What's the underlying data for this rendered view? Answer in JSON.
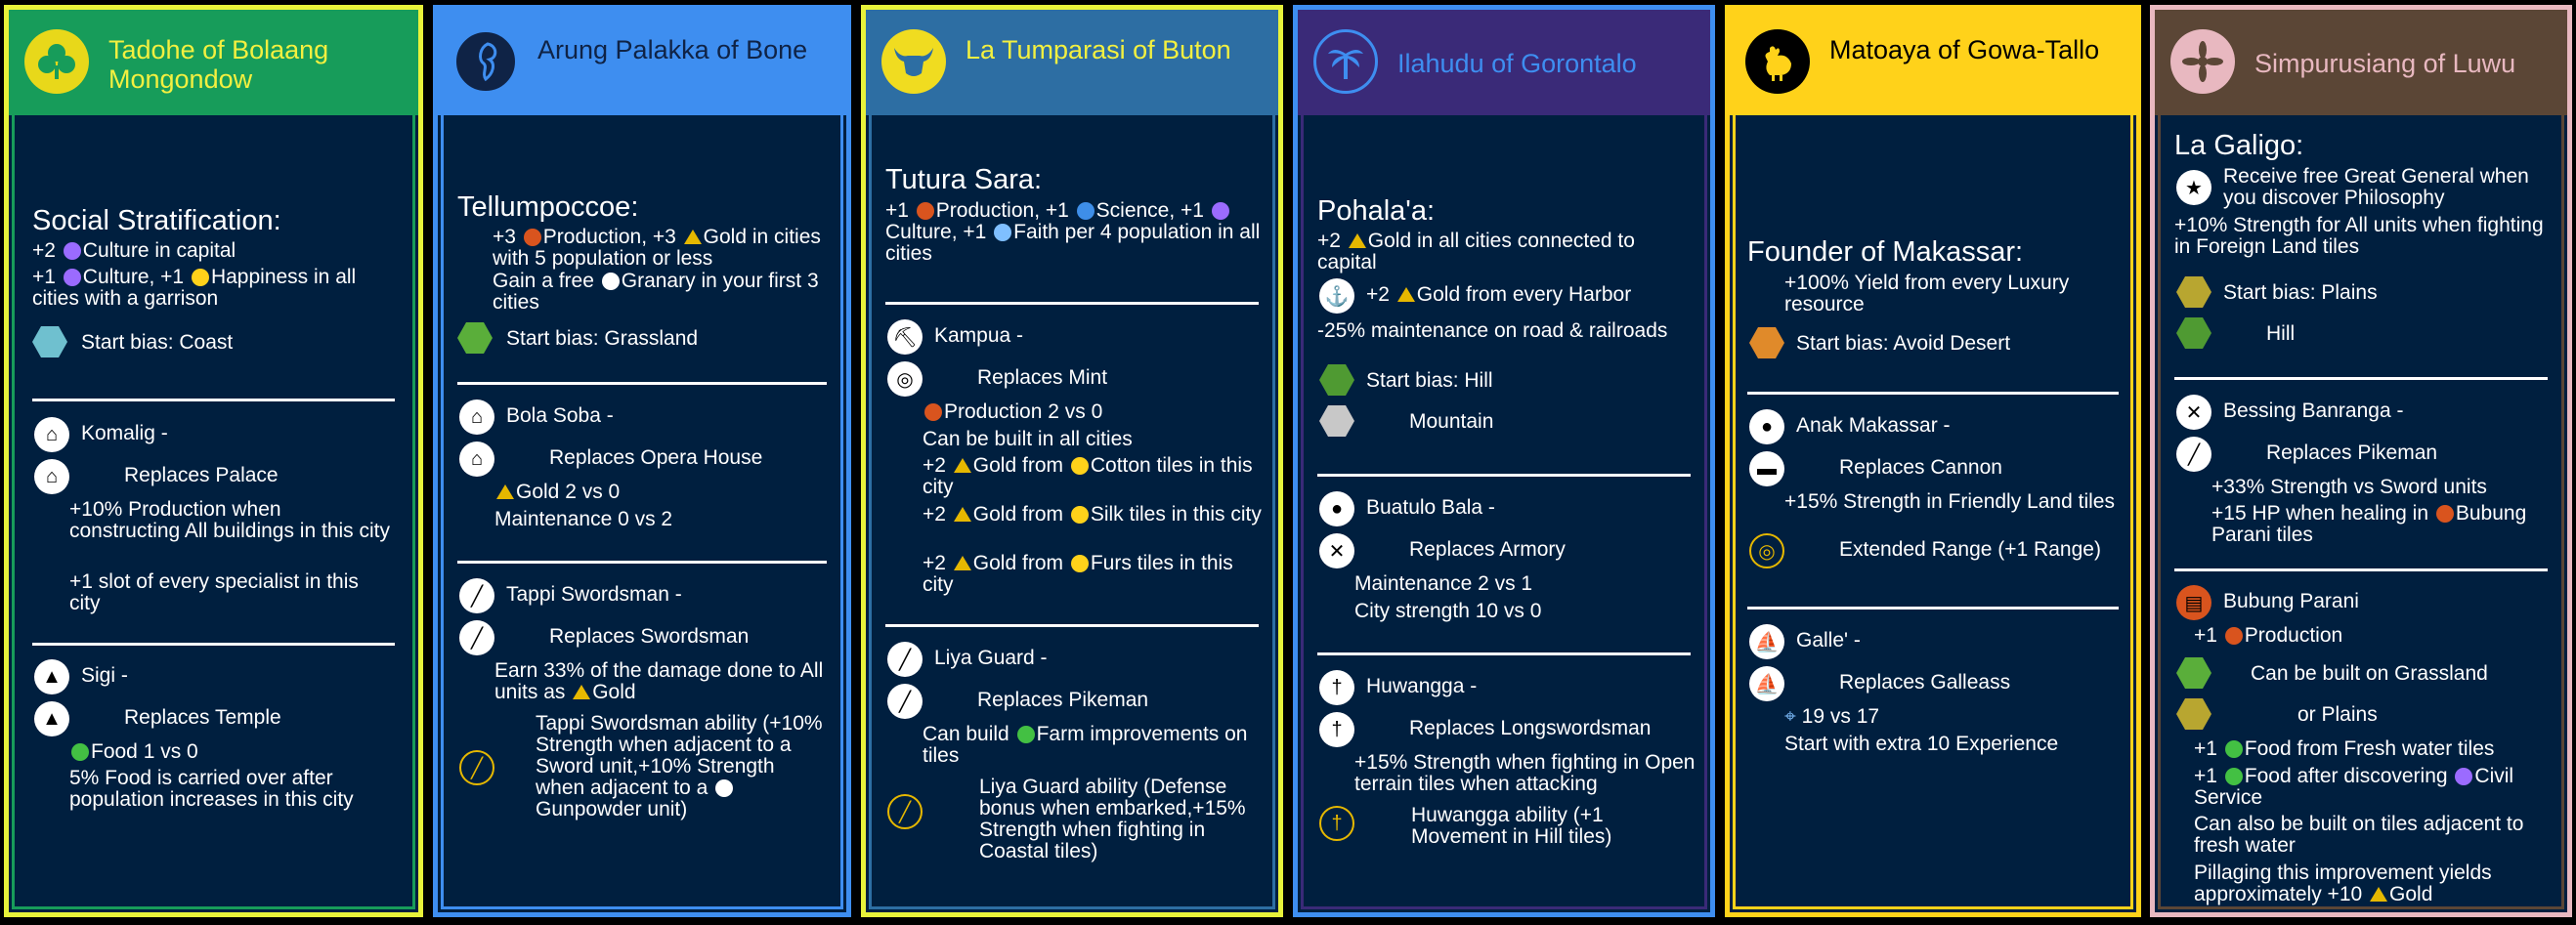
{
  "colors": {
    "bg": "#001f3f",
    "culture": "#9b6bff",
    "gold": "#e6b800",
    "production": "#d9541e",
    "science": "#3e8ee8",
    "faith": "#7fbfff",
    "happy": "#ffd21a",
    "food": "#43c043"
  },
  "c1": {
    "name": "Tadohe of Bolaang Mongondow",
    "ability": "Social Stratification:",
    "l1": "+2",
    "l1b": "Culture in capital",
    "l2": "+1",
    "l2b": "Culture, +1",
    "l2c": "Happiness in all cities with a garrison",
    "bias": "Start bias: Coast",
    "u1": "Komalig -",
    "u1r": "Replaces Palace",
    "u1a": "+10% Production when constructing All buildings in this city",
    "u1b": "+1 slot of every specialist in this city",
    "u2": "Sigi -",
    "u2r": "Replaces Temple",
    "u2a": "Food 1 vs 0",
    "u2b": "5% Food is carried over after population increases in this city"
  },
  "c2": {
    "name": "Arung Palakka of Bone",
    "ability": "Tellumpoccoe:",
    "l1": "+3",
    "l1b": "Production, +3",
    "l1c": "Gold in cities with 5 population or less",
    "l2": "Gain a free",
    "l2b": "Granary in your first 3 cities",
    "bias": "Start bias: Grassland",
    "u1": "Bola Soba -",
    "u1r": "Replaces Opera House",
    "u1a": "Gold 2 vs 0",
    "u1b": "Maintenance 0 vs 2",
    "u2": "Tappi Swordsman -",
    "u2r": "Replaces Swordsman",
    "u2a": "Earn 33% of the damage done to All units as",
    "u2a2": "Gold",
    "u2b": "Tappi Swordsman ability (+10% Strength when adjacent to a Sword unit,+10% Strength when adjacent to a",
    "u2b2": "Gunpowder unit)"
  },
  "c3": {
    "name": "La Tumparasi of Buton",
    "ability": "Tutura Sara:",
    "l1": "+1",
    "l1b": "Production, +1",
    "l1c": "Science, +1",
    "l1d": "Culture, +1",
    "l1e": "Faith per 4 population in all cities",
    "u1": "Kampua -",
    "u1r": "Replaces Mint",
    "u1a": "Production 2 vs 0",
    "u1b": "Can be built in all cities",
    "u1c": "+2",
    "u1c2": "Gold from",
    "u1c3": "Cotton tiles in this city",
    "u1d": "+2",
    "u1d2": "Gold from",
    "u1d3": "Silk tiles in this city",
    "u1e": "+2",
    "u1e2": "Gold from",
    "u1e3": "Furs tiles in this city",
    "u2": "Liya Guard -",
    "u2r": "Replaces Pikeman",
    "u2a": "Can build",
    "u2a2": "Farm improvements on tiles",
    "u2b": "Liya Guard ability (Defense bonus when embarked,+15% Strength when fighting in Coastal tiles)"
  },
  "c4": {
    "name": "Ilahudu of Gorontalo",
    "ability": "Pohala'a:",
    "l1": "+2",
    "l1b": "Gold in all cities connected to capital",
    "l2": "+2",
    "l2b": "Gold from every Harbor",
    "l3": "-25% maintenance on road & railroads",
    "bias": "Start bias: Hill",
    "bias2": "Mountain",
    "u1": "Buatulo Bala -",
    "u1r": "Replaces Armory",
    "u1a": "Maintenance 2 vs 1",
    "u1b": "City strength 10 vs 0",
    "u2": "Huwangga -",
    "u2r": "Replaces Longswordsman",
    "u2a": "+15% Strength when fighting in Open terrain tiles when attacking",
    "u2b": "Huwangga ability (+1 Movement in Hill tiles)"
  },
  "c5": {
    "name": "Matoaya of Gowa-Tallo",
    "ability": "Founder of Makassar:",
    "l1": "+100% Yield from every Luxury resource",
    "bias": "Start bias: Avoid Desert",
    "u1": "Anak Makassar -",
    "u1r": "Replaces Cannon",
    "u1a": "+15% Strength in Friendly Land tiles",
    "u1b": "Extended Range (+1 Range)",
    "u2": "Galle' -",
    "u2r": "Replaces Galleass",
    "u2a": "19 vs 17",
    "u2b": "Start with extra 10 Experience"
  },
  "c6": {
    "name": "Simpurusiang of Luwu",
    "ability": "La Galigo:",
    "l1": "Receive free Great General when you discover Philosophy",
    "l2": "+10% Strength for All units when fighting in Foreign Land tiles",
    "bias": "Start bias: Plains",
    "bias2": "Hill",
    "u1": "Bessing Banranga -",
    "u1r": "Replaces Pikeman",
    "u1a": "+33% Strength vs Sword units",
    "u1b": "+15 HP when healing in",
    "u1b2": "Bubung Parani tiles",
    "u2": "Bubung Parani",
    "u2a": "+1",
    "u2a2": "Production",
    "u2b": "Can be built on Grassland",
    "u2c": "or Plains",
    "u2d": "+1",
    "u2d2": "Food from Fresh water tiles",
    "u2e": "+1",
    "u2e2": "Food after discovering",
    "u2e3": "Civil Service",
    "u2f": "Can also be built on tiles adjacent to fresh water",
    "u2g": "Pillaging this improvement yields approximately +10",
    "u2g2": "Gold"
  }
}
